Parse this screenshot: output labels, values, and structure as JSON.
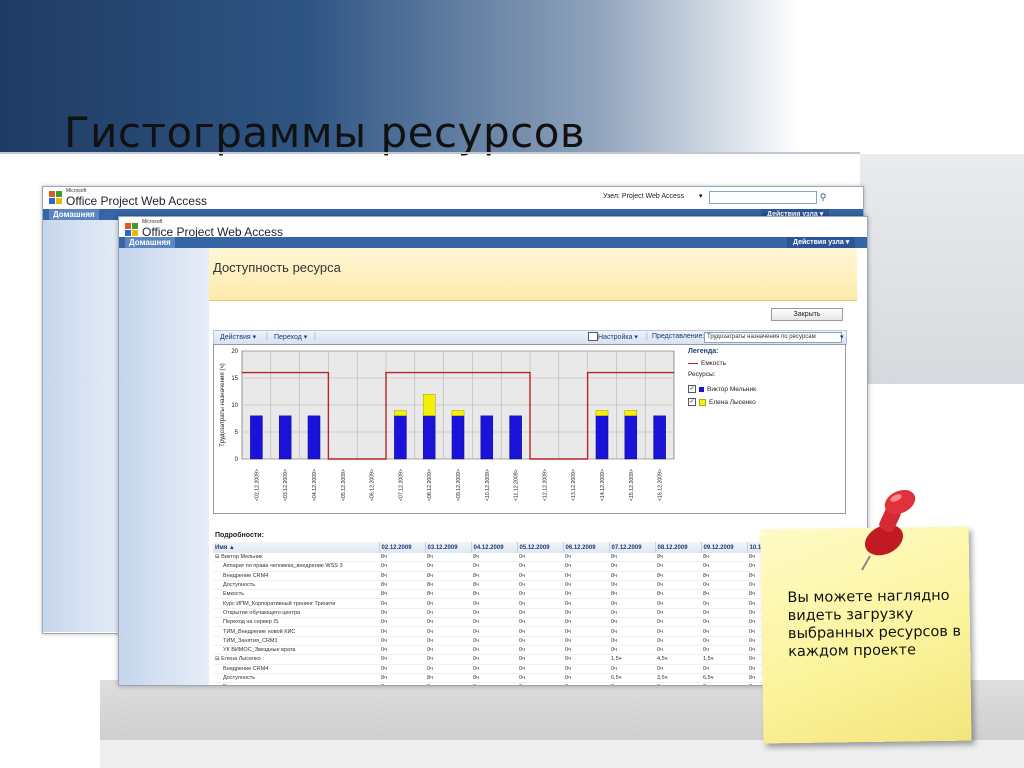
{
  "slide": {
    "title": "Гистограммы ресурсов"
  },
  "back_window": {
    "logo_small": "Microsoft",
    "logo_text": "Office Project Web Access",
    "site_label": "Узел: Project Web Access",
    "tab_home": "Домашняя",
    "site_actions": "Действия узла ▾"
  },
  "front_window": {
    "logo_small": "Microsoft",
    "logo_text": "Office Project Web Access",
    "tab_home": "Домашняя",
    "site_actions": "Действия узла ▾",
    "page_title": "Доступность ресурса",
    "close_label": "Закрыть",
    "toolbar": {
      "actions": "Действия ▾",
      "go": "Переход ▾",
      "settings": "Настройка ▾",
      "view_label": "Представление:",
      "view_value": "Трудозатраты назначения по ресурсам"
    },
    "legend": {
      "title": "Легенда:",
      "capacity": "Емкость",
      "resources_label": "Ресурсы:",
      "resources": [
        {
          "name": "Виктор Мельник",
          "color": "#1a12d8",
          "checked": "✓"
        },
        {
          "name": "Елена Лысенко",
          "color": "#f5f00a",
          "checked": "✓"
        }
      ]
    },
    "details": {
      "title": "Подробности:",
      "headers": [
        "Имя ▲",
        "02.12.2009",
        "03.12.2009",
        "04.12.2009",
        "05.12.2009",
        "06.12.2009",
        "07.12.2009",
        "08.12.2009",
        "09.12.2009",
        "10.12.2009",
        "11.12.200"
      ],
      "rows": [
        {
          "level": 0,
          "cells": [
            "⊟ Виктор Мельник",
            "8ч",
            "8ч",
            "8ч",
            "0ч",
            "0ч",
            "8ч",
            "8ч",
            "8ч",
            "8ч",
            ""
          ]
        },
        {
          "level": 1,
          "cells": [
            "Аппарат по права человека_внедрение WSS 3",
            "0ч",
            "0ч",
            "0ч",
            "0ч",
            "0ч",
            "0ч",
            "0ч",
            "0ч",
            "0ч",
            ""
          ]
        },
        {
          "level": 1,
          "cells": [
            "Внедрение CRM4",
            "8ч",
            "8ч",
            "8ч",
            "0ч",
            "0ч",
            "8ч",
            "8ч",
            "8ч",
            "8ч",
            ""
          ]
        },
        {
          "level": 1,
          "cells": [
            "Доступность",
            "8ч",
            "8ч",
            "8ч",
            "0ч",
            "0ч",
            "0ч",
            "0ч",
            "0ч",
            "0ч",
            ""
          ]
        },
        {
          "level": 1,
          "cells": [
            "Емкость",
            "8ч",
            "8ч",
            "8ч",
            "0ч",
            "0ч",
            "8ч",
            "8ч",
            "8ч",
            "8ч",
            ""
          ]
        },
        {
          "level": 1,
          "cells": [
            "Курс ИПМ_Корпоративный тренинг Тринити",
            "0ч",
            "0ч",
            "0ч",
            "0ч",
            "0ч",
            "0ч",
            "0ч",
            "0ч",
            "0ч",
            ""
          ]
        },
        {
          "level": 1,
          "cells": [
            "Открытие обучающего центра",
            "0ч",
            "0ч",
            "0ч",
            "0ч",
            "0ч",
            "0ч",
            "0ч",
            "0ч",
            "0ч",
            ""
          ]
        },
        {
          "level": 1,
          "cells": [
            "Переход на сервер IS",
            "0ч",
            "0ч",
            "0ч",
            "0ч",
            "0ч",
            "0ч",
            "0ч",
            "0ч",
            "0ч",
            ""
          ]
        },
        {
          "level": 1,
          "cells": [
            "ТИМ_Внедрение новой КИС",
            "0ч",
            "0ч",
            "0ч",
            "0ч",
            "0ч",
            "0ч",
            "0ч",
            "0ч",
            "0ч",
            ""
          ]
        },
        {
          "level": 1,
          "cells": [
            "ТИМ_Занятия_CRM1",
            "0ч",
            "0ч",
            "0ч",
            "0ч",
            "0ч",
            "0ч",
            "0ч",
            "0ч",
            "0ч",
            ""
          ]
        },
        {
          "level": 1,
          "cells": [
            "УК ВИМОС_Звездные врата",
            "0ч",
            "0ч",
            "0ч",
            "0ч",
            "0ч",
            "0ч",
            "0ч",
            "0ч",
            "0ч",
            ""
          ]
        },
        {
          "level": 0,
          "cells": [
            "⊟ Елена Лысенко",
            "0ч",
            "0ч",
            "0ч",
            "0ч",
            "0ч",
            "1,5ч",
            "4,5ч",
            "1,5ч",
            "0ч",
            ""
          ]
        },
        {
          "level": 1,
          "cells": [
            "Внедрение CRM4",
            "0ч",
            "0ч",
            "0ч",
            "0ч",
            "0ч",
            "0ч",
            "0ч",
            "0ч",
            "0ч",
            ""
          ]
        },
        {
          "level": 1,
          "cells": [
            "Доступность",
            "8ч",
            "8ч",
            "8ч",
            "0ч",
            "0ч",
            "6,5ч",
            "3,5ч",
            "6,5ч",
            "8ч",
            ""
          ]
        },
        {
          "level": 1,
          "cells": [
            "Емкость",
            "8ч",
            "8ч",
            "8ч",
            "0ч",
            "0ч",
            "8ч",
            "8ч",
            "8ч",
            "8ч",
            ""
          ]
        },
        {
          "level": 1,
          "cells": [
            "План проведения круглого стола",
            "0ч",
            "0ч",
            "0ч",
            "0ч",
            "0ч",
            "1,5ч",
            "4,5ч",
            "1,5ч",
            "0ч",
            ""
          ]
        }
      ]
    }
  },
  "chart_data": {
    "type": "bar",
    "title": "",
    "xlabel": "",
    "ylabel": "Трудозатраты назначения (ч)",
    "ylim": [
      0,
      20
    ],
    "yticks": [
      0,
      5,
      10,
      15,
      20
    ],
    "grid": true,
    "categories": [
      "02.12.2009",
      "03.12.2009",
      "04.12.2009",
      "05.12.2009",
      "06.12.2009",
      "07.12.2009",
      "08.12.2009",
      "09.12.2009",
      "10.12.2009",
      "11.12.2009",
      "12.12.2009",
      "13.12.2009",
      "14.12.2009",
      "15.12.2009",
      "16.12.2009"
    ],
    "series": [
      {
        "name": "Виктор Мельник",
        "color": "#1a12d8",
        "values": [
          8,
          8,
          8,
          0,
          0,
          8,
          8,
          8,
          8,
          8,
          0,
          0,
          8,
          8,
          8
        ]
      },
      {
        "name": "Елена Лысенко",
        "color": "#f5f00a",
        "values": [
          0,
          0,
          0,
          0,
          0,
          1,
          4,
          1,
          0,
          0,
          0,
          0,
          1,
          1,
          0
        ]
      }
    ],
    "line": {
      "name": "Емкость",
      "color": "#b3262a",
      "values": [
        16,
        16,
        16,
        0,
        0,
        16,
        16,
        16,
        16,
        16,
        0,
        0,
        16,
        16,
        16
      ]
    }
  },
  "note": {
    "text": "Вы можете наглядно видеть загрузку выбранных ресурсов в каждом проекте"
  },
  "colors": {
    "accent": "#3665a6",
    "pin": "#d0202a"
  }
}
